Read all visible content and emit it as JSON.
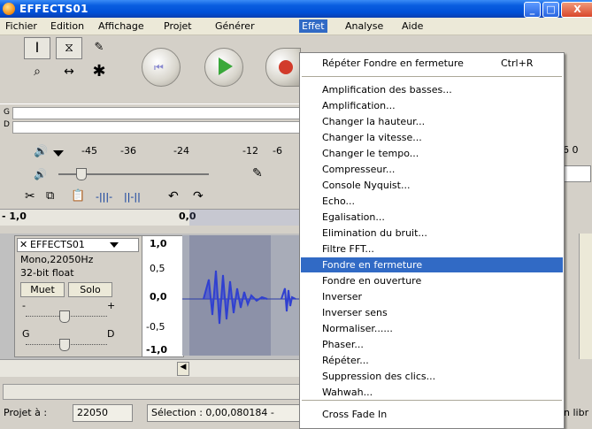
{
  "window": {
    "title": "EFFECTS01",
    "minimize": "_",
    "maximize": "□",
    "close": "X"
  },
  "menubar": [
    "Fichier",
    "Edition",
    "Affichage",
    "Projet",
    "Générer",
    "Effet",
    "Analyse",
    "Aide"
  ],
  "effect_menu": {
    "top": [
      {
        "label": "Répéter Fondre en fermeture",
        "shortcut": "Ctrl+R"
      }
    ],
    "items": [
      "Amplification des basses...",
      "Amplification...",
      "Changer la hauteur...",
      "Changer la vitesse...",
      "Changer le tempo...",
      "Compresseur...",
      "Console Nyquist...",
      "Echo...",
      "Egalisation...",
      "Elimination du bruit...",
      "Filtre FFT...",
      "Fondre en fermeture",
      "Fondre en ouverture",
      "Inverser",
      "Inverser sens",
      "Normaliser......",
      "Phaser...",
      "Répéter...",
      "Suppression des clics...",
      "Wahwah..."
    ],
    "highlighted": "Fondre en fermeture",
    "bottom": [
      "Cross Fade In"
    ]
  },
  "meter": {
    "lr_labels": [
      "G",
      "D"
    ],
    "scale": [
      "-45",
      "-36",
      "-24",
      "-12",
      "-6"
    ],
    "right_partial": "6 0"
  },
  "ruler": {
    "left": "- 1,0",
    "mid": "0,0"
  },
  "track": {
    "name": "EFFECTS01",
    "format": "Mono,22050Hz",
    "bits": "32-bit float",
    "mute": "Muet",
    "solo": "Solo",
    "gain_minus": "-",
    "gain_plus": "+",
    "pan_left": "G",
    "pan_right": "D",
    "scale": [
      "1,0",
      "0,5",
      "0,0",
      "-0,5",
      "-1,0"
    ]
  },
  "status": {
    "rate_label": "Projet à :",
    "rate_value": "22050",
    "selection": "Sélection : 0,00,080184 -",
    "right_partial": "n libr"
  }
}
